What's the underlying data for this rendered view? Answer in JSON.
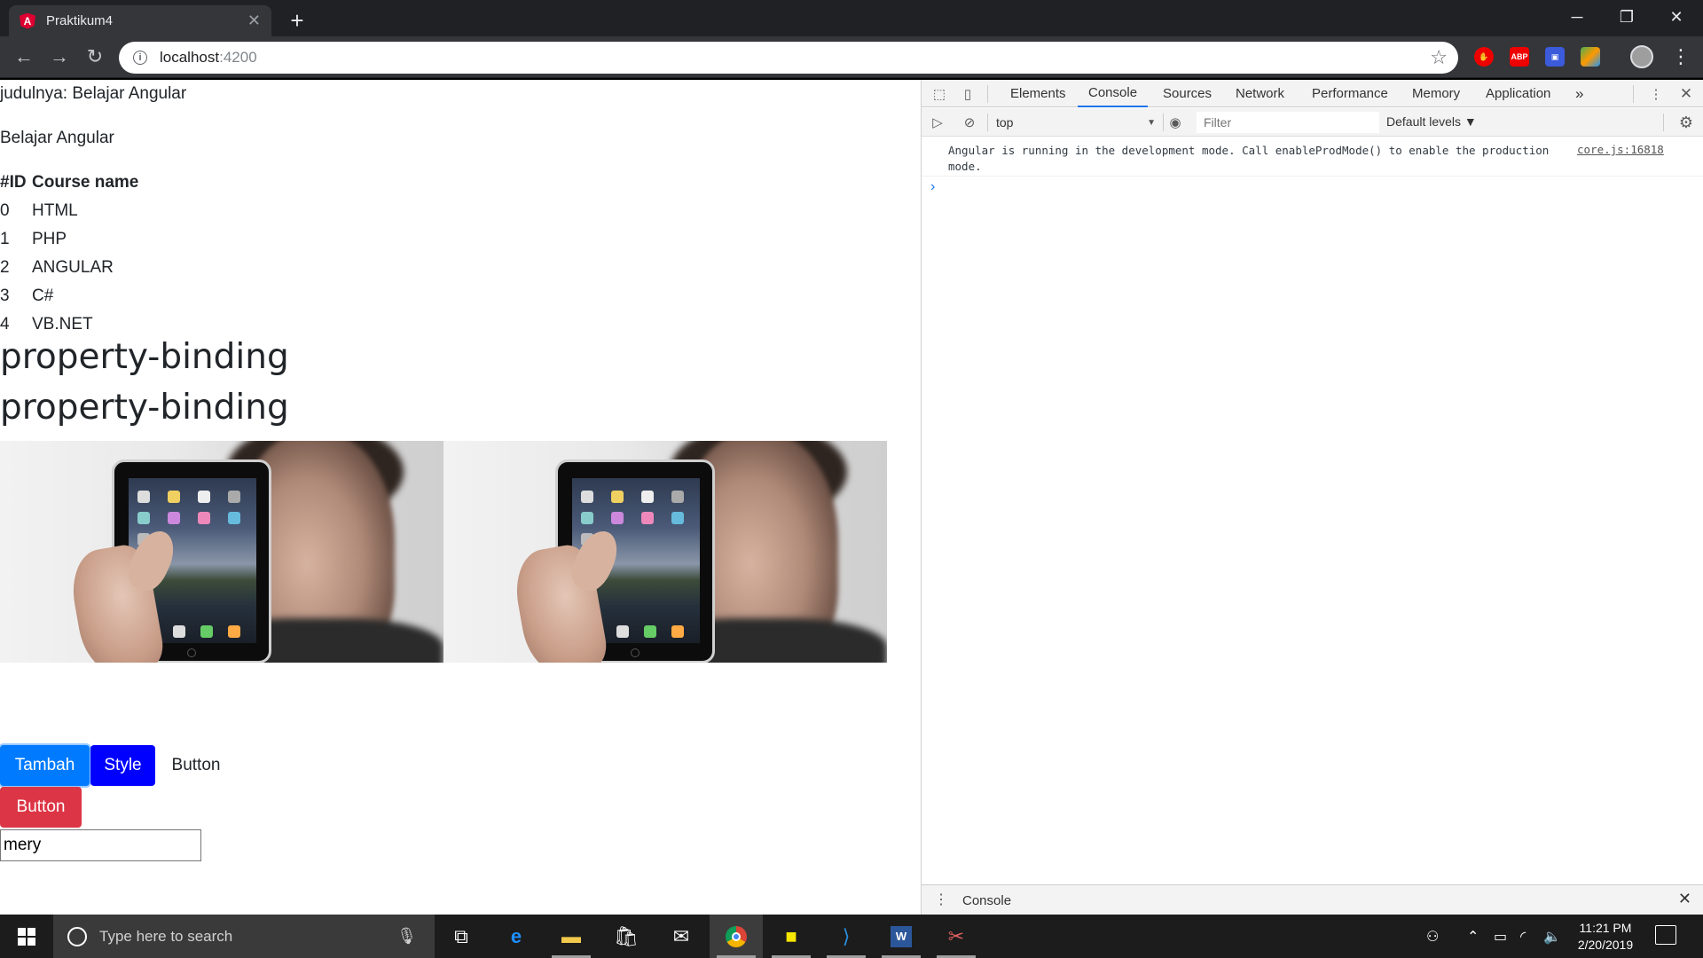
{
  "browser": {
    "tab_title": "Praktikum4",
    "url_host": "localhost",
    "url_port": ":4200"
  },
  "page": {
    "title_line": "judulnya: Belajar Angular",
    "subtitle": "Belajar Angular",
    "table": {
      "headers": [
        "#ID",
        "Course name"
      ],
      "rows": [
        [
          "0",
          "HTML"
        ],
        [
          "1",
          "PHP"
        ],
        [
          "2",
          "ANGULAR"
        ],
        [
          "3",
          "C#"
        ],
        [
          "4",
          "VB.NET"
        ]
      ]
    },
    "heading1": "property-binding",
    "heading2": "property-binding",
    "buttons": {
      "tambah": "Tambah",
      "style": "Style",
      "plain": "Button",
      "danger": "Button"
    },
    "input_value": "mery"
  },
  "devtools": {
    "tabs": [
      "Elements",
      "Console",
      "Sources",
      "Network",
      "Performance",
      "Memory",
      "Application"
    ],
    "active_tab": "Console",
    "more_tabs": "»",
    "context": "top",
    "filter_placeholder": "Filter",
    "levels": "Default levels ▼",
    "log_message": "Angular is running in the development mode. Call enableProdMode() to enable the production mode.",
    "log_source": "core.js:16818",
    "drawer_label": "Console"
  },
  "taskbar": {
    "search_placeholder": "Type here to search",
    "time": "11:21 PM",
    "date": "2/20/2019"
  },
  "colors": {
    "primary": "#007bff",
    "style_blue": "#0000ff",
    "danger": "#dc3545"
  }
}
